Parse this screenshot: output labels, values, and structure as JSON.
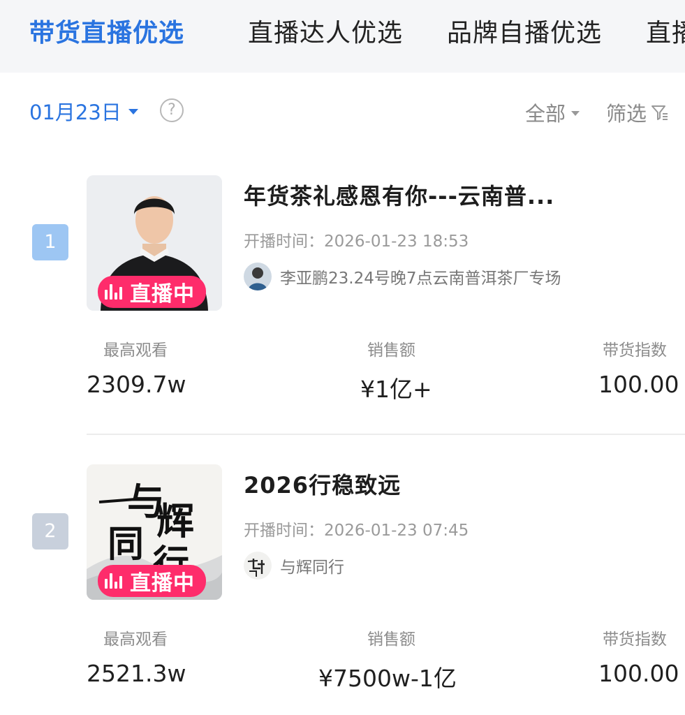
{
  "tabs": [
    {
      "label": "带货直播优选",
      "active": true
    },
    {
      "label": "直播达人优选",
      "active": false
    },
    {
      "label": "品牌自播优选",
      "active": false
    },
    {
      "label": "直播",
      "active": false
    }
  ],
  "filters": {
    "date": "01月23日",
    "help": "?",
    "scope": "全部",
    "filter": "筛选"
  },
  "stat_labels": {
    "peak_viewers": "最高观看",
    "sales": "销售额",
    "sales_index": "带货指数"
  },
  "items": [
    {
      "rank": "1",
      "live_badge": "直播中",
      "title": "年货茶礼感恩有你---云南普...",
      "start_time": "开播时间：2026-01-23 18:53",
      "anchor": "李亚鹏23.24号晚7点云南普洱茶厂专场",
      "peak_viewers": "2309.7w",
      "sales": "¥1亿+",
      "sales_index": "100.00"
    },
    {
      "rank": "2",
      "live_badge": "直播中",
      "title": "2026行稳致远",
      "start_time": "开播时间：2026-01-23 07:45",
      "anchor": "与辉同行",
      "thumb_text": "与辉同行",
      "peak_viewers": "2521.3w",
      "sales": "¥7500w-1亿",
      "sales_index": "100.00"
    }
  ],
  "colors": {
    "accent": "#2a74e0",
    "live": "#fe2c6b",
    "rank1": "#9dc6f3",
    "rank2": "#c8d0dc"
  }
}
